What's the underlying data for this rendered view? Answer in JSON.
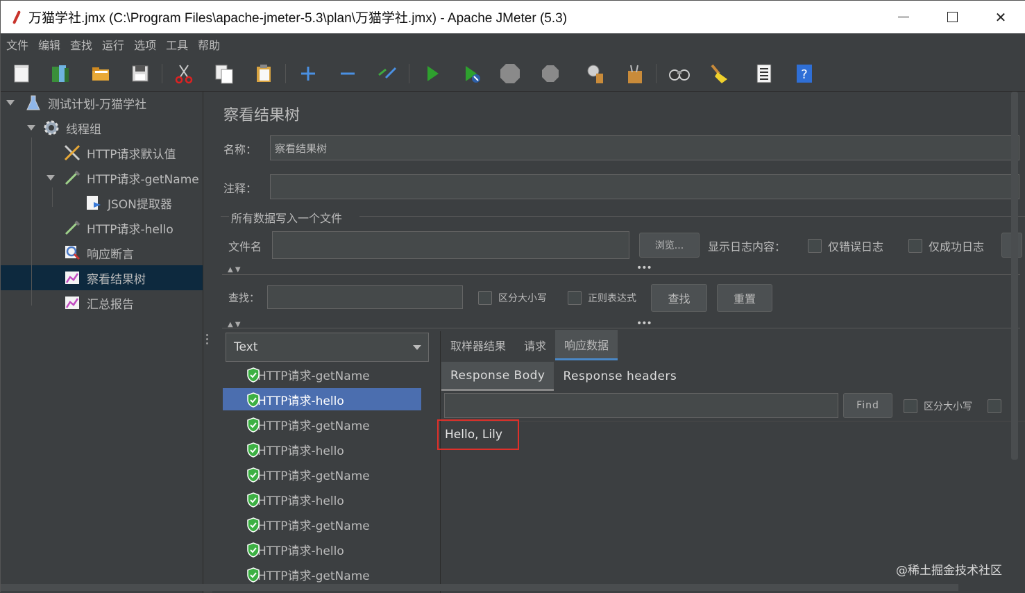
{
  "window": {
    "title": "万猫学社.jmx (C:\\Program Files\\apache-jmeter-5.3\\plan\\万猫学社.jmx) - Apache JMeter (5.3)",
    "close_glyph": "✕"
  },
  "menu": [
    "文件",
    "编辑",
    "查找",
    "运行",
    "选项",
    "工具",
    "帮助"
  ],
  "toolbar": {
    "icons": [
      "new-icon",
      "templates-icon",
      "open-icon",
      "save-icon",
      "cut-icon",
      "copy-icon",
      "paste-icon",
      "expand-icon",
      "collapse-icon",
      "toggle-icon",
      "start-icon",
      "start-no-pause-icon",
      "stop-icon",
      "shutdown-icon",
      "clear-icon",
      "clear-all-icon",
      "search-icon",
      "reset-search-icon",
      "function-helper-icon",
      "help-icon"
    ]
  },
  "tree": {
    "items": [
      {
        "label": "测试计划-万猫学社",
        "icon": "test-plan-icon"
      },
      {
        "label": "线程组",
        "icon": "gear-icon"
      },
      {
        "label": "HTTP请求默认值",
        "icon": "tools-icon"
      },
      {
        "label": "HTTP请求-getName",
        "icon": "pipette-icon"
      },
      {
        "label": "JSON提取器",
        "icon": "extractor-icon"
      },
      {
        "label": "HTTP请求-hello",
        "icon": "pipette-icon"
      },
      {
        "label": "响应断言",
        "icon": "magnifier-icon"
      },
      {
        "label": "察看结果树",
        "icon": "chart-icon"
      },
      {
        "label": "汇总报告",
        "icon": "chart-icon"
      }
    ],
    "selected_index": 7
  },
  "panel": {
    "heading": "察看结果树",
    "name_label": "名称：",
    "name_value": "察看结果树",
    "comment_label": "注释：",
    "comment_value": "",
    "file_group_label": "所有数据写入一个文件",
    "filename_label": "文件名",
    "filename_value": "",
    "browse_label": "浏览...",
    "log_label": "显示日志内容：",
    "errors_only_label": "仅错误日志",
    "success_only_label": "仅成功日志",
    "search_label": "查找：",
    "search_value": "",
    "case_sensitive_label": "区分大小写",
    "regex_label": "正则表达式",
    "find_button": "查找",
    "reset_button": "重置"
  },
  "results": {
    "renderer": "Text",
    "items": [
      {
        "label": "HTTP请求-getName",
        "status": "success"
      },
      {
        "label": "HTTP请求-hello",
        "status": "success"
      },
      {
        "label": "HTTP请求-getName",
        "status": "success"
      },
      {
        "label": "HTTP请求-hello",
        "status": "success"
      },
      {
        "label": "HTTP请求-getName",
        "status": "success"
      },
      {
        "label": "HTTP请求-hello",
        "status": "success"
      },
      {
        "label": "HTTP请求-getName",
        "status": "success"
      },
      {
        "label": "HTTP请求-hello",
        "status": "success"
      },
      {
        "label": "HTTP请求-getName",
        "status": "success"
      }
    ],
    "selected_index": 1
  },
  "detail": {
    "tabs": [
      "取样器结果",
      "请求",
      "响应数据"
    ],
    "active_tab": 2,
    "subtabs": [
      "Response Body",
      "Response headers"
    ],
    "active_subtab": 0,
    "find_value": "",
    "find_button": "Find",
    "case_label": "区分大小写",
    "response_text": "Hello, Lily"
  },
  "footer_watermark": "@稀土掘金技术社区",
  "colors": {
    "background": "#3c3f41",
    "selection": "#4b6eaf",
    "tree_selection": "#0d293e",
    "highlight_box": "#e0302a",
    "success": "#3cb043"
  }
}
